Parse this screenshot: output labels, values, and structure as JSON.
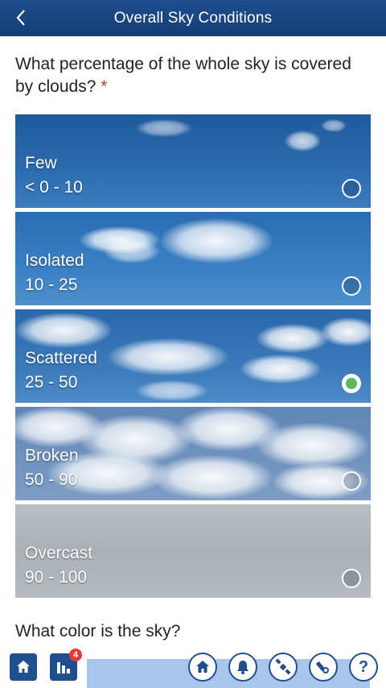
{
  "header": {
    "title": "Overall Sky Conditions"
  },
  "question": {
    "text": "What percentage of the whole sky is covered by clouds?",
    "required_mark": "*"
  },
  "options": [
    {
      "name": "Few",
      "range": "< 0 - 10",
      "selected": false
    },
    {
      "name": "Isolated",
      "range": "10 - 25",
      "selected": false
    },
    {
      "name": "Scattered",
      "range": "25 - 50",
      "selected": true
    },
    {
      "name": "Broken",
      "range": "50 - 90",
      "selected": false
    },
    {
      "name": "Overcast",
      "range": "90 - 100",
      "selected": false
    }
  ],
  "question2": {
    "text": "What color is the sky?"
  },
  "bottom_bar": {
    "badge_count": "4",
    "help_label": "?",
    "icons": [
      "home-icon",
      "bar-chart-icon",
      "home-icon",
      "bell-icon",
      "satellite-icon",
      "telescope-icon",
      "help-icon"
    ]
  },
  "colors": {
    "header": "#1f4f8f",
    "selected": "#5cb85c",
    "required": "#d32f2f"
  }
}
